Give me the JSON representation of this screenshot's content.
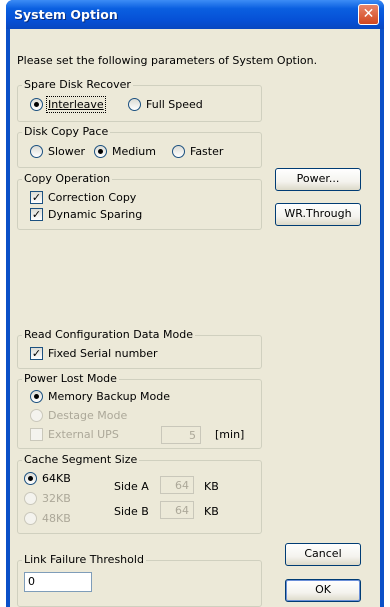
{
  "window": {
    "title": "System Option",
    "close_glyph": "✕"
  },
  "intro": "Please set the following parameters of System Option.",
  "spare_disk": {
    "legend": "Spare Disk Recover",
    "options": [
      {
        "label": "Interleave",
        "selected": true
      },
      {
        "label": "Full Speed",
        "selected": false
      }
    ]
  },
  "copy_pace": {
    "legend": "Disk Copy Pace",
    "options": [
      {
        "label": "Slower",
        "selected": false
      },
      {
        "label": "Medium",
        "selected": true
      },
      {
        "label": "Faster",
        "selected": false
      }
    ]
  },
  "copy_op": {
    "legend": "Copy Operation",
    "items": [
      {
        "label": "Correction Copy",
        "checked": true
      },
      {
        "label": "Dynamic Sparing",
        "checked": true
      }
    ]
  },
  "buttons": {
    "power": "Power...",
    "wr_through": "WR.Through",
    "cancel": "Cancel",
    "ok": "OK"
  },
  "read_config": {
    "legend": "Read Configuration Data Mode",
    "item": {
      "label": "Fixed Serial number",
      "checked": true
    }
  },
  "power_lost": {
    "legend": "Power Lost Mode",
    "options": [
      {
        "label": "Memory Backup Mode",
        "selected": true,
        "enabled": true
      },
      {
        "label": "Destage Mode",
        "selected": false,
        "enabled": false
      }
    ],
    "external_ups": {
      "label": "External UPS",
      "checked": false,
      "enabled": false
    },
    "ups_value": "5",
    "ups_unit": "[min]"
  },
  "cache_segment": {
    "legend": "Cache Segment Size",
    "options": [
      {
        "label": "64KB",
        "selected": true,
        "enabled": true
      },
      {
        "label": "32KB",
        "selected": false,
        "enabled": false
      },
      {
        "label": "48KB",
        "selected": false,
        "enabled": false
      }
    ],
    "side_a_label": "Side A",
    "side_a_value": "64",
    "side_b_label": "Side B",
    "side_b_value": "64",
    "unit": "KB"
  },
  "link_failure": {
    "legend": "Link Failure Threshold",
    "value": "0"
  }
}
